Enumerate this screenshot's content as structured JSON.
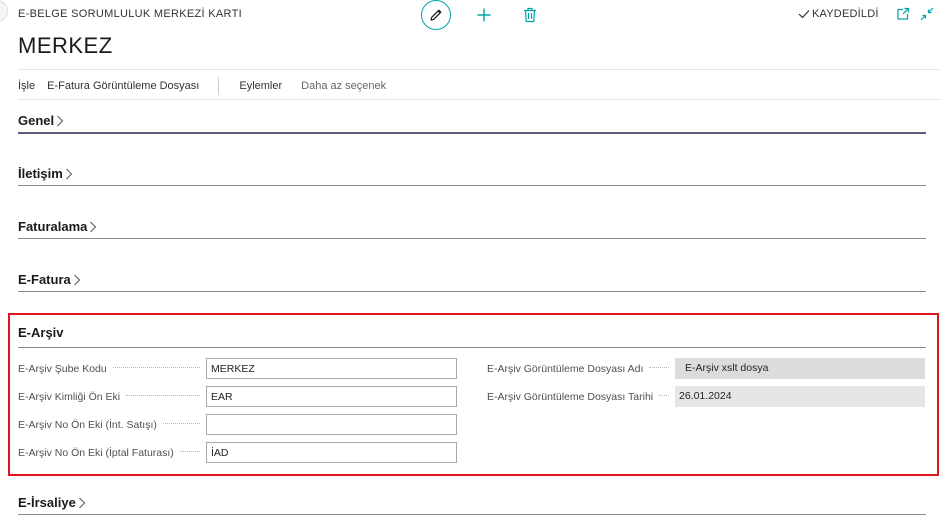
{
  "header": {
    "caption": "E-BELGE SORUMLULUK MERKEZİ KARTI",
    "title": "MERKEZ",
    "status": "KAYDEDİLDİ"
  },
  "actions": {
    "process": "İşle",
    "efatura_view": "E-Fatura Görüntüleme Dosyası",
    "actions": "Eylemler",
    "fewer": "Daha az seçenek"
  },
  "sections": {
    "genel": "Genel",
    "iletisim": "İletişim",
    "faturalama": "Faturalama",
    "efatura": "E-Fatura",
    "earsiv": "E-Arşiv",
    "eirsaliye": "E-İrsaliye"
  },
  "earsiv_fields": {
    "sube_kodu": {
      "label": "E-Arşiv Şube Kodu",
      "value": "MERKEZ"
    },
    "kimlik_on_eki": {
      "label": "E-Arşiv Kimliği Ön Eki",
      "value": "EAR"
    },
    "no_int_satisi": {
      "label": "E-Arşiv No Ön Eki (İnt. Satışı)",
      "value": ""
    },
    "no_iptal": {
      "label": "E-Arşiv No Ön Eki (İptal Faturası)",
      "value": "İAD"
    },
    "gorunt_dosya_adi": {
      "label": "E-Arşiv Görüntüleme Dosyası Adı",
      "value": "E-Arşiv xslt dosya"
    },
    "gorunt_dosya_tarihi": {
      "label": "E-Arşiv Görüntüleme Dosyası Tarihi",
      "value": "26.01.2024"
    }
  },
  "colors": {
    "accent": "#00a3a3",
    "highlight": "#e0141e"
  },
  "icons": [
    "pencil-icon",
    "plus-icon",
    "trash-icon",
    "checkmark-icon",
    "open-in-new-window-icon",
    "collapse-icon",
    "chevron-right-icon"
  ]
}
